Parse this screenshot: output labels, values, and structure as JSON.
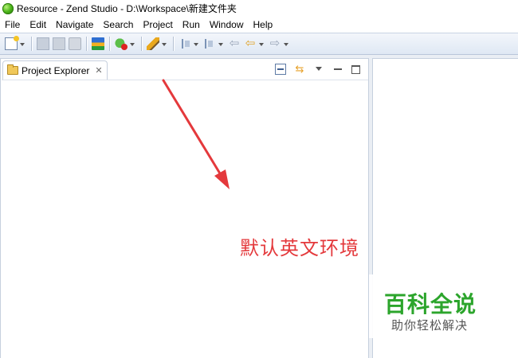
{
  "window": {
    "title": "Resource - Zend Studio - D:\\Workspace\\新建文件夹"
  },
  "menu": [
    "File",
    "Edit",
    "Navigate",
    "Search",
    "Project",
    "Run",
    "Window",
    "Help"
  ],
  "toolbar": {
    "icons": [
      "new-icon",
      "save-icon",
      "save-all-icon",
      "print-icon",
      "open-workspace-icon",
      "debug-icon",
      "edit-pen-icon",
      "next-annotation-icon",
      "previous-annotation-icon",
      "back-arrow-icon",
      "forward-arrow-icon"
    ]
  },
  "explorer": {
    "tab_label": "Project Explorer",
    "close_glyph": "✕",
    "link_glyph": "⇆"
  },
  "annotation": {
    "text": "默认英文环境",
    "color": "#e4393c"
  },
  "watermark": {
    "title": "百科全说",
    "subtitle": "助你轻松解决",
    "title_color": "#2ca52c"
  }
}
